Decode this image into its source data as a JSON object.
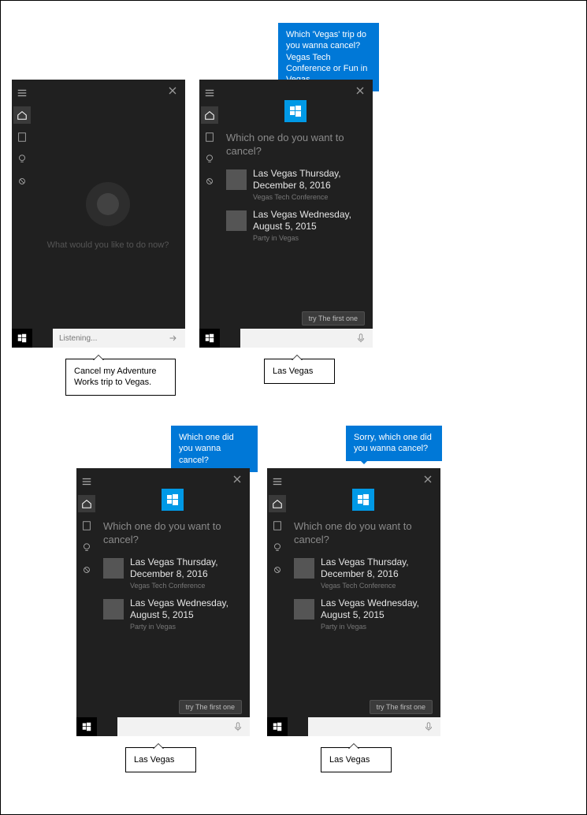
{
  "panels": {
    "p1": {
      "prompt": "What would you like to do now?",
      "input_text": "Listening...",
      "user_bubble": "Cancel my Adventure Works trip to Vegas."
    },
    "p2": {
      "system_bubble": "Which 'Vegas' trip do you wanna cancel? Vegas Tech Conference or Fun in Vegas.",
      "question": "Which one do you want to cancel?",
      "items": [
        {
          "title": "Las Vegas Thursday, December 8, 2016",
          "subtitle": "Vegas Tech Conference"
        },
        {
          "title": "Las Vegas Wednesday, August 5, 2015",
          "subtitle": "Party in Vegas"
        }
      ],
      "hint": "try The first one",
      "user_bubble": "Las Vegas"
    },
    "p3": {
      "system_bubble": "Which one did you wanna cancel?",
      "question": "Which one do you want to cancel?",
      "items": [
        {
          "title": "Las Vegas Thursday, December 8, 2016",
          "subtitle": "Vegas Tech Conference"
        },
        {
          "title": "Las Vegas Wednesday, August 5, 2015",
          "subtitle": "Party in Vegas"
        }
      ],
      "hint": "try The first one",
      "user_bubble": "Las Vegas"
    },
    "p4": {
      "system_bubble": "Sorry, which one did you wanna cancel?",
      "question": "Which one do you want to cancel?",
      "items": [
        {
          "title": "Las Vegas Thursday, December 8, 2016",
          "subtitle": "Vegas Tech Conference"
        },
        {
          "title": "Las Vegas Wednesday, August 5, 2015",
          "subtitle": "Party in Vegas"
        }
      ],
      "hint": "try The first one",
      "user_bubble": "Las Vegas"
    }
  }
}
